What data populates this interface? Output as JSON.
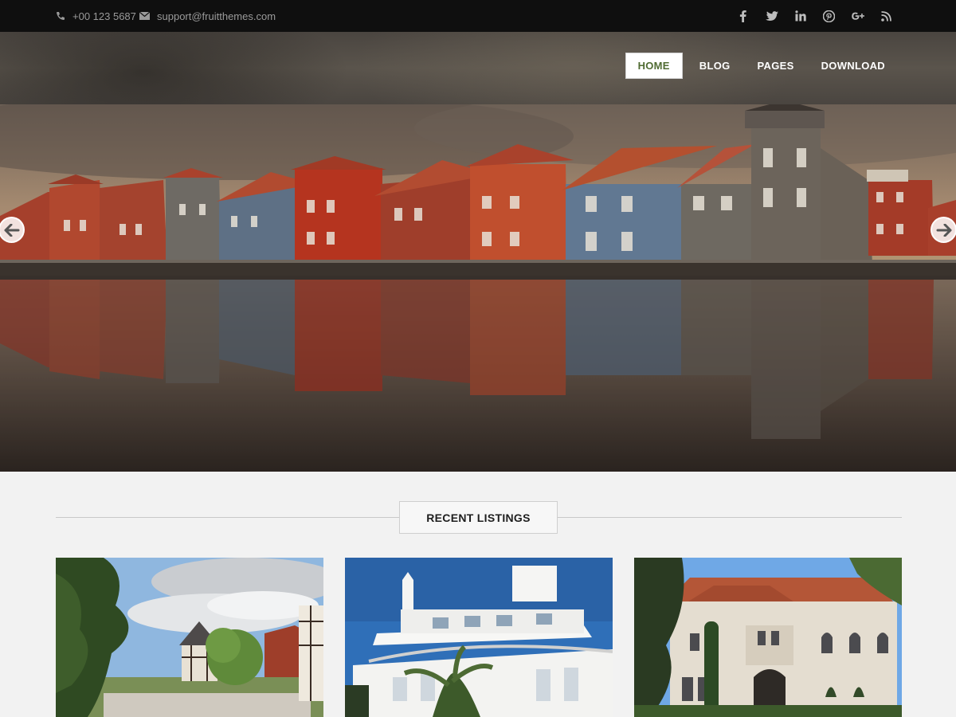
{
  "topbar": {
    "phone": "+00 123 5687",
    "email": "support@fruitthemes.com",
    "social": [
      {
        "icon": "facebook-icon",
        "glyph": "f"
      },
      {
        "icon": "twitter-icon",
        "glyph": "t"
      },
      {
        "icon": "linkedin-icon",
        "glyph": "in"
      },
      {
        "icon": "pinterest-icon",
        "glyph": "p"
      },
      {
        "icon": "google-plus-icon",
        "glyph": "g+"
      },
      {
        "icon": "rss-icon",
        "glyph": "rss"
      }
    ]
  },
  "nav": {
    "items": [
      "HOME",
      "BLOG",
      "PAGES",
      "DOWNLOAD"
    ],
    "active": "HOME"
  },
  "hero": {
    "prev_icon": "arrow-left-circle-icon",
    "next_icon": "arrow-right-circle-icon"
  },
  "listings": {
    "title": "RECENT LISTINGS"
  },
  "colors": {
    "topbar_bg": "#0f0f0f",
    "nav_active_text": "#4f6b32",
    "page_bg": "#f2f2f2"
  }
}
